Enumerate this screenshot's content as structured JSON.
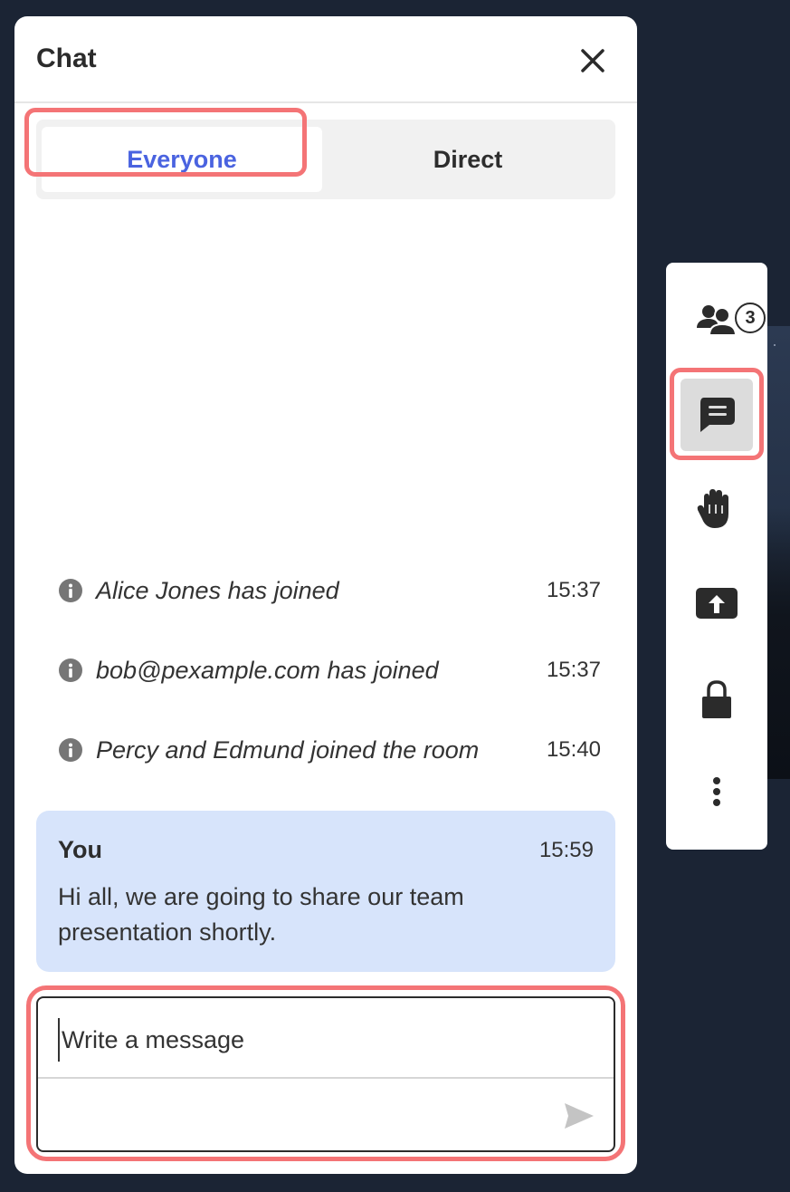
{
  "panel": {
    "title": "Chat",
    "close_label": "Close"
  },
  "tabs": [
    {
      "label": "Everyone",
      "selected": true
    },
    {
      "label": "Direct",
      "selected": false
    }
  ],
  "system_messages": [
    {
      "text": "Alice Jones has joined",
      "time": "15:37"
    },
    {
      "text": "bob@pexample.com has joined",
      "time": "15:37"
    },
    {
      "text": "Percy and Edmund joined the room",
      "time": "15:40"
    }
  ],
  "message": {
    "author": "You",
    "time": "15:59",
    "text": "Hi all, we are going to share our team presentation shortly."
  },
  "composer": {
    "placeholder": "Write a message",
    "value": ""
  },
  "toolbar": {
    "participants_count": "3",
    "items": [
      {
        "icon": "participants-icon"
      },
      {
        "icon": "chat-icon",
        "active": true
      },
      {
        "icon": "raise-hand-icon"
      },
      {
        "icon": "share-screen-icon"
      },
      {
        "icon": "lock-icon"
      },
      {
        "icon": "more-icon"
      }
    ]
  },
  "colors": {
    "accent": "#4a63e0",
    "highlight": "#f47476",
    "bubble": "#d7e4fb",
    "background": "#1b2434"
  }
}
